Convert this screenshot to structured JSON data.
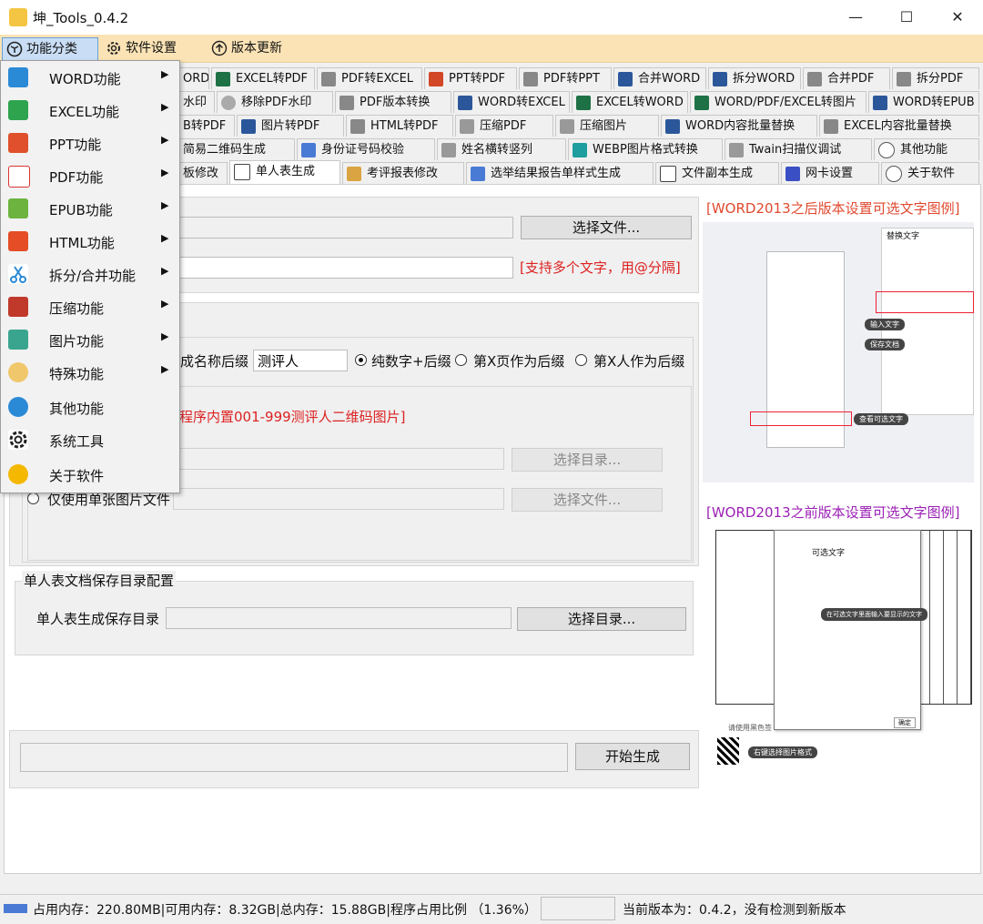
{
  "window": {
    "title": "坤_Tools_0.4.2",
    "minimize": "—",
    "maximize": "☐",
    "close": "✕"
  },
  "menubar": {
    "items": [
      {
        "label": "功能分类"
      },
      {
        "label": "软件设置"
      },
      {
        "label": "版本更新"
      }
    ]
  },
  "tabs": {
    "row1": [
      "ORD",
      "EXCEL转PDF",
      "PDF转EXCEL",
      "PPT转PDF",
      "PDF转PPT",
      "合并WORD",
      "拆分WORD",
      "合并PDF",
      "拆分PDF"
    ],
    "row2": [
      "水印",
      "移除PDF水印",
      "PDF版本转换",
      "WORD转EXCEL",
      "EXCEL转WORD",
      "WORD/PDF/EXCEL转图片",
      "WORD转EPUB"
    ],
    "row3": [
      "B转PDF",
      "图片转PDF",
      "HTML转PDF",
      "压缩PDF",
      "压缩图片",
      "WORD内容批量替换",
      "EXCEL内容批量替换"
    ],
    "row4": [
      "简易二维码生成",
      "身份证号码校验",
      "姓名横转竖列",
      "WEBP图片格式转换",
      "Twain扫描仪调试",
      "其他功能"
    ],
    "row5": [
      "板修改",
      "单人表生成",
      "考评报表修改",
      "选举结果报告单样式生成",
      "文件副本生成",
      "网卡设置",
      "关于软件"
    ]
  },
  "form": {
    "select_file_button": "选择文件...",
    "multi_text_hint": "[支持多个文字，用@分隔]",
    "name_suffix_label": "成名称后缀",
    "name_suffix_value": "测评人",
    "radio_pure_number": "纯数字+后缀",
    "radio_page_x": "第X页作为后缀",
    "radio_person_x": "第X人作为后缀",
    "builtin_hint": "程序内置001-999测评人二维码图片]",
    "select_dir_button": "选择目录...",
    "single_image_radio": "仅使用单张图片文件",
    "select_file_button2": "选择文件...",
    "save_group_title": "单人表文档保存目录配置",
    "save_dir_label": "单人表生成保存目录",
    "save_dir_button": "选择目录...",
    "start_button": "开始生成"
  },
  "right_panel": {
    "caption_after": "[WORD2013之后版本设置可选文字图例]",
    "caption_before": "[WORD2013之前版本设置可选文字图例]",
    "shot1_title": "替换文字",
    "shot1_tag_input": "输入文字",
    "shot1_tag_save": "保存文档",
    "shot1_tag_view": "查看可选文字",
    "shot2_title": "可选文字",
    "shot2_tag": "在可选文字里面输入要显示的文字",
    "shot2_ok": "确定",
    "shot2_hint": "请使用黑色签",
    "shot2_qr_tag": "右键选择图片格式"
  },
  "dropdown": {
    "items": [
      {
        "label": "WORD功能",
        "arrow": "▶"
      },
      {
        "label": "EXCEL功能",
        "arrow": "▶"
      },
      {
        "label": "PPT功能",
        "arrow": "▶"
      },
      {
        "label": "PDF功能",
        "arrow": "▶"
      },
      {
        "label": "EPUB功能",
        "arrow": "▶"
      },
      {
        "label": "HTML功能",
        "arrow": "▶"
      },
      {
        "label": "拆分/合并功能",
        "arrow": "▶"
      },
      {
        "label": "压缩功能",
        "arrow": "▶"
      },
      {
        "label": "图片功能",
        "arrow": "▶"
      },
      {
        "label": "特殊功能",
        "arrow": "▶"
      },
      {
        "label": "其他功能",
        "arrow": ""
      },
      {
        "label": "系统工具",
        "arrow": ""
      },
      {
        "label": "关于软件",
        "arrow": ""
      }
    ]
  },
  "statusbar": {
    "memory": "占用内存：220.80MB|可用内存：8.32GB|总内存：15.88GB|程序占用比例 （1.36%）",
    "version": "当前版本为：0.4.2，没有检测到新版本"
  }
}
